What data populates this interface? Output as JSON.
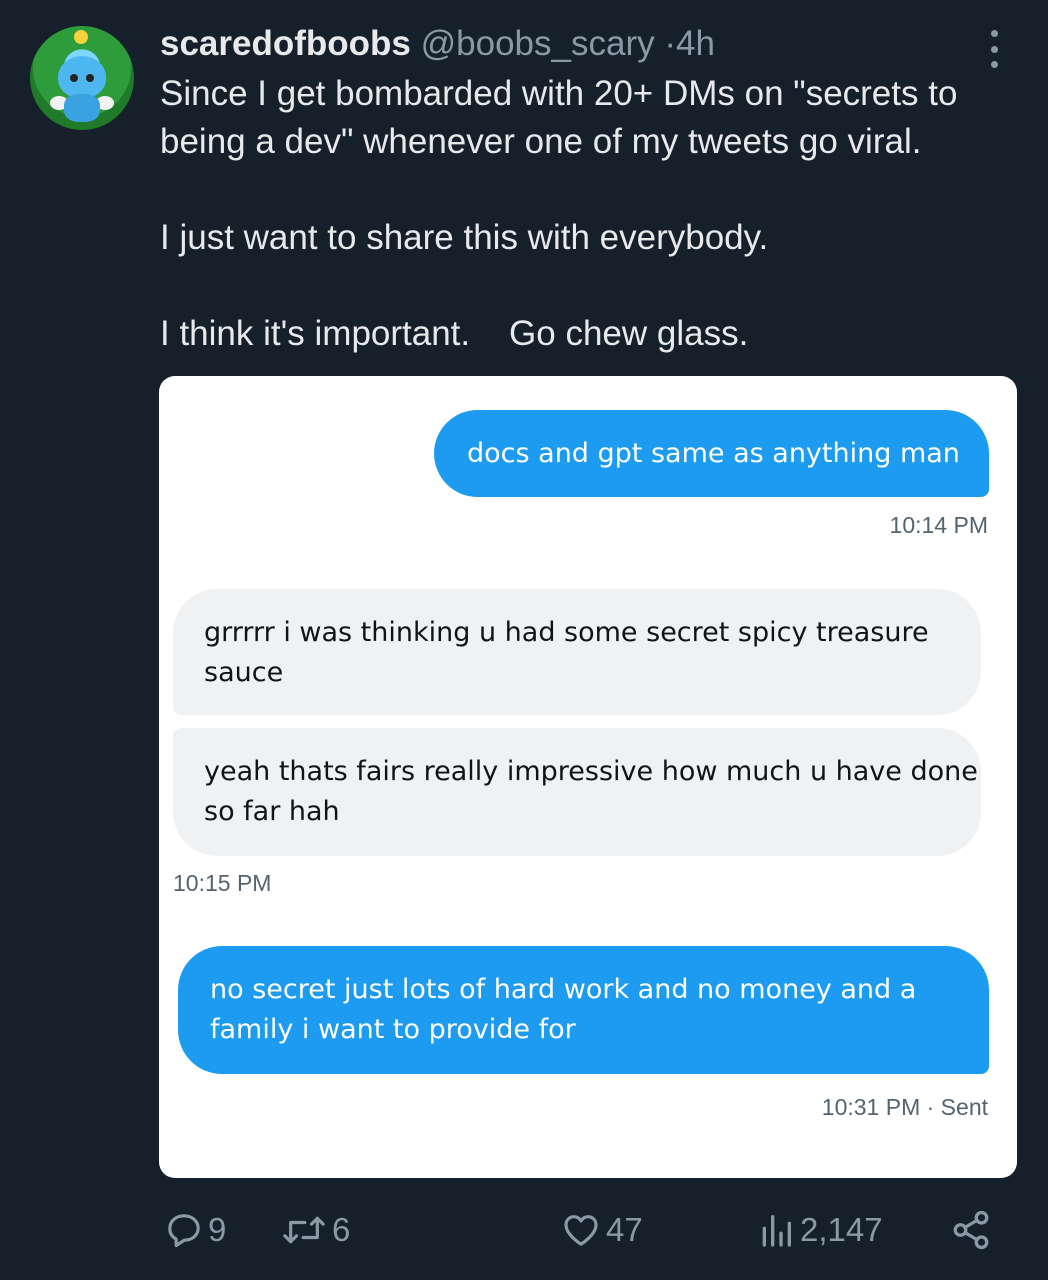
{
  "tweet": {
    "display_name": "scaredofboobs",
    "handle": "@boobs_scary",
    "separator": "·",
    "time": "4h",
    "paragraphs": [
      "Since I get bombarded with 20+ DMs on \"secrets to being a dev\" whenever one of my tweets go viral.",
      "I just want to share this with everybody.",
      "I think it's important.    Go chew glass."
    ]
  },
  "dm": {
    "messages": [
      {
        "text": "docs and gpt same as anything man",
        "direction": "outgoing"
      },
      {
        "text": "grrrrr i was thinking u had some secret spicy treasure sauce",
        "direction": "incoming"
      },
      {
        "text": "yeah thats fairs really impressive how much u have done so far hah",
        "direction": "incoming"
      },
      {
        "text": "no secret just lots of hard work and no money and a family i want to provide for",
        "direction": "outgoing"
      }
    ],
    "timestamps": [
      "10:14 PM",
      "10:15 PM",
      "10:31 PM · Sent"
    ],
    "colors": {
      "outgoing": "#1d9bf0",
      "incoming": "#eff1f3"
    }
  },
  "actions": {
    "reply": {
      "icon": "reply-icon",
      "count": "9"
    },
    "retweet": {
      "icon": "retweet-icon",
      "count": "6"
    },
    "like": {
      "icon": "heart-icon",
      "count": "47"
    },
    "views": {
      "icon": "views-icon",
      "count": "2,147"
    },
    "share": {
      "icon": "share-icon"
    }
  },
  "colors": {
    "background": "#15202b",
    "text": "#e7e9ea",
    "muted": "#8b98a5"
  }
}
